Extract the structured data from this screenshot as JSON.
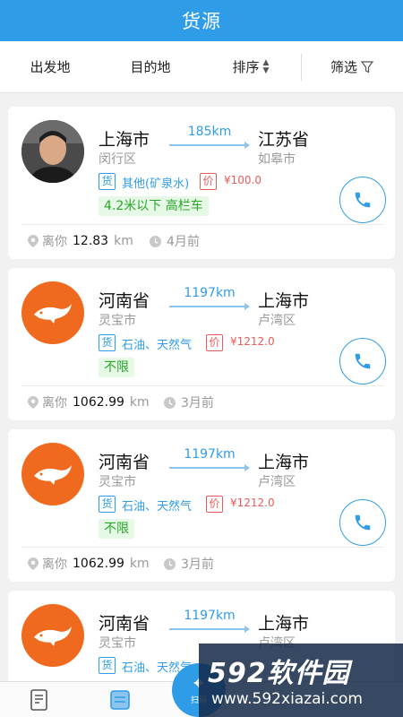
{
  "header": {
    "title": "货源"
  },
  "filters": {
    "origin": "出发地",
    "destination": "目的地",
    "sort": "排序",
    "filter": "筛选"
  },
  "cards": [
    {
      "from_city": "上海市",
      "from_district": "闵行区",
      "distance": "185km",
      "to_city": "江苏省",
      "to_district": "如皋市",
      "goods_tag": "货",
      "goods": "其他(矿泉水)",
      "price_tag": "价",
      "price": "¥100.0",
      "vehicle": "4.2米以下 高栏车",
      "near_label": "离你",
      "near_value": "12.83",
      "near_unit": "km",
      "time": "4月前",
      "avatar": "person-photo"
    },
    {
      "from_city": "河南省",
      "from_district": "灵宝市",
      "distance": "1197km",
      "to_city": "上海市",
      "to_district": "卢湾区",
      "goods_tag": "货",
      "goods": "石油、天然气",
      "price_tag": "价",
      "price": "¥1212.0",
      "vehicle": "不限",
      "near_label": "离你",
      "near_value": "1062.99",
      "near_unit": "km",
      "time": "3月前",
      "avatar": "fish-logo"
    },
    {
      "from_city": "河南省",
      "from_district": "灵宝市",
      "distance": "1197km",
      "to_city": "上海市",
      "to_district": "卢湾区",
      "goods_tag": "货",
      "goods": "石油、天然气",
      "price_tag": "价",
      "price": "¥1212.0",
      "vehicle": "不限",
      "near_label": "离你",
      "near_value": "1062.99",
      "near_unit": "km",
      "time": "3月前",
      "avatar": "fish-logo"
    },
    {
      "from_city": "河南省",
      "from_district": "灵宝市",
      "distance": "1197km",
      "to_city": "上海市",
      "to_district": "卢湾区",
      "goods_tag": "货",
      "goods": "石油、天然气",
      "avatar": "fish-logo"
    }
  ],
  "tabbar": {
    "scan_label": "扫码"
  },
  "watermark": {
    "logo": "592软件园",
    "url": "www.592xiazai.com"
  },
  "colors": {
    "primary": "#2f9ce8",
    "price": "#e85b5b",
    "vehicle": "#2aa52a",
    "avatar_orange": "#ef6a1e"
  }
}
